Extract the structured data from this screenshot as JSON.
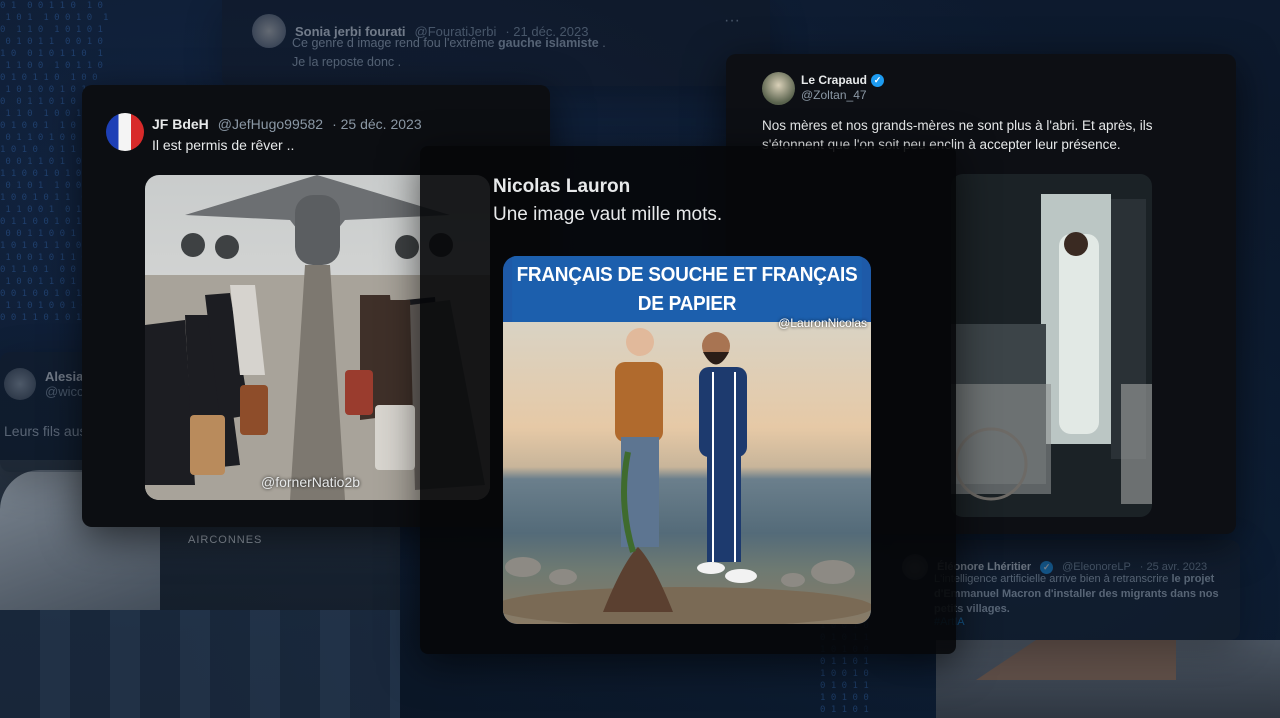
{
  "background": {
    "tweet_top": {
      "name": "Sonia jerbi fourati",
      "handle": "@FouratiJerbi",
      "date": "· 21 déc. 2023",
      "line1_prefix": "Ce genre d image rend fou l'extrême ",
      "line1_bold": "gauche islamiste",
      "line1_suffix": " .",
      "line2": "Je la reposte donc ."
    },
    "tweet_left": {
      "name": "Alesia Rogn",
      "handle": "@wicca",
      "text": "Leurs fils aussi"
    },
    "tweet_bottom_right": {
      "name": "Éléonore Lhéritier",
      "handle": "@EleonoreLP",
      "date": "· 25 avr. 2023",
      "text_prefix": "L'intelligence artificielle arrive bien à retranscrire ",
      "text_bold": "le projet d'Emmanuel Macron d'installer des migrants dans nos petits villages.",
      "hashtag": "#ArtIA"
    },
    "photo_label": "AIRCONNES"
  },
  "card_jf": {
    "name": "JF BdeH",
    "handle": "@JefHugo99582",
    "date": "· 25 déc. 2023",
    "text": "Il est permis de rêver ..",
    "media_watermark": "@fornerNatio2b",
    "avatar": "french-flag-icon"
  },
  "card_crapaud": {
    "name": "Le Crapaud",
    "handle": "@Zoltan_47",
    "text": "Nos mères et nos grands-mères ne sont plus à l'abri. Et après, ils s'étonnent que l'on soit peu enclin à accepter leur présence."
  },
  "card_nicolas": {
    "name": "Nicolas Lauron",
    "text": "Une image vaut mille mots.",
    "banner_line1": "FRANÇAIS DE SOUCHE ET FRANÇAIS",
    "banner_line2": "DE PAPIER",
    "media_watermark": "@LauronNicolas"
  },
  "colors": {
    "background": "#0b1524",
    "card": "#0d0f13",
    "verified": "#1d9bf0",
    "banner": "#1c5fad",
    "muted": "#8b98a5"
  }
}
